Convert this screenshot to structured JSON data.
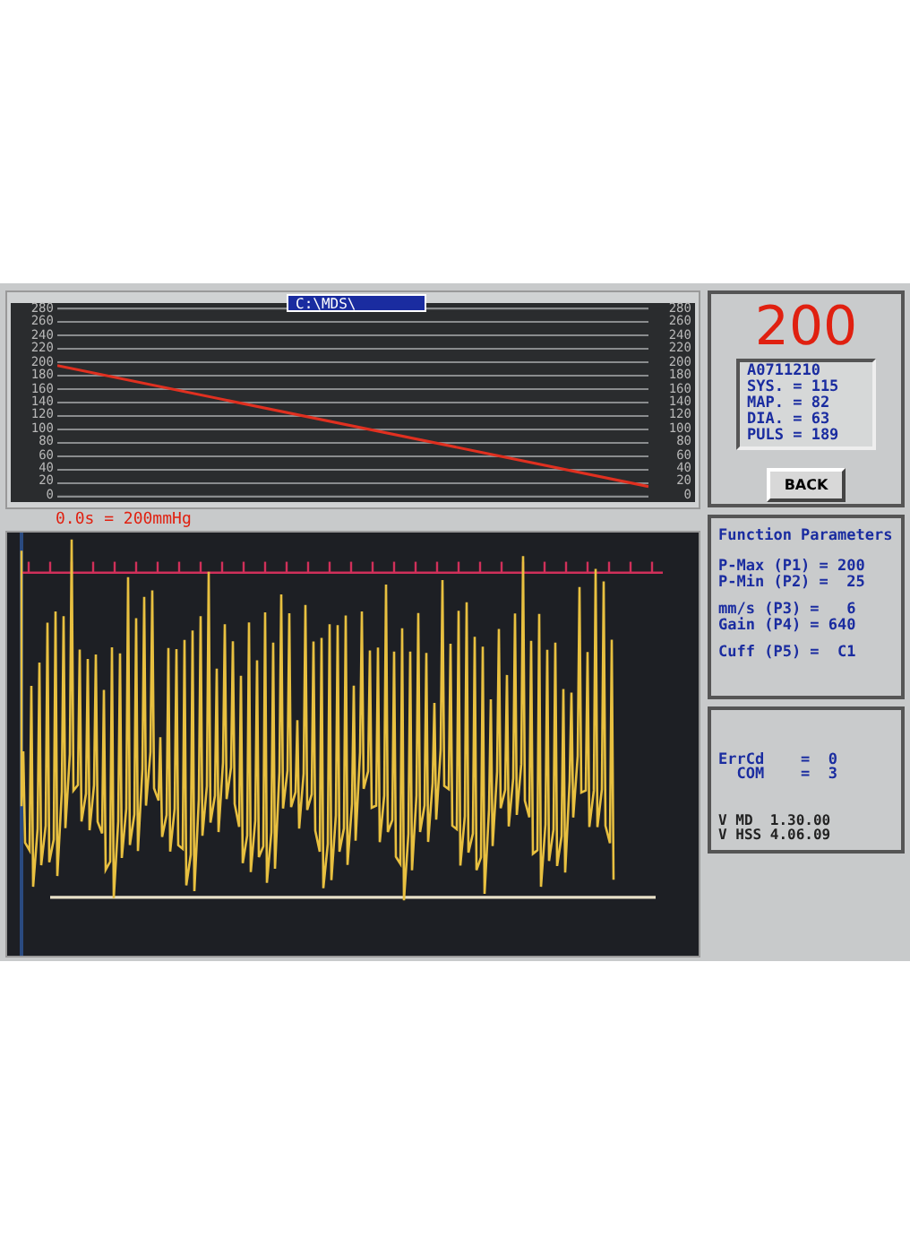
{
  "title_tab": "C:\\MDS\\",
  "pressure_chart": {
    "left_axis_labels": [
      "280",
      "260",
      "240",
      "220",
      "200",
      "180",
      "160",
      "140",
      "120",
      "100",
      "80",
      "60",
      "40",
      "20",
      "0"
    ],
    "right_axis_labels": [
      "280",
      "260",
      "240",
      "220",
      "200",
      "180",
      "160",
      "140",
      "120",
      "100",
      "80",
      "60",
      "40",
      "20",
      "0"
    ]
  },
  "cursor_label": "0.0s = 200mmHg",
  "result": {
    "value": "200",
    "lines": [
      "A0711210",
      "SYS. = 115",
      "MAP. = 82",
      "DIA. = 63",
      "PULS = 189"
    ],
    "back_button": "BACK"
  },
  "function_parameters": {
    "title": "Function Parameters",
    "groups": [
      [
        "P-Max (P1) = 200",
        "P-Min (P2) =  25"
      ],
      [
        "mm/s (P3) =   6",
        "Gain (P4) = 640"
      ],
      [
        "Cuff (P5) =  C1"
      ]
    ]
  },
  "status": {
    "lines": [
      "ErrCd    =  0",
      "  COM    =  3"
    ],
    "versions": [
      "V MD  1.30.00",
      "V HSS 4.06.09"
    ]
  }
}
